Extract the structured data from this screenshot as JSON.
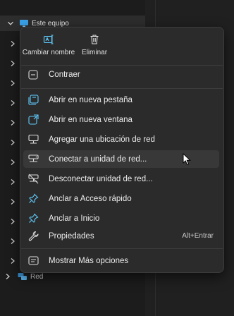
{
  "tree": {
    "root_label": "Este equipo",
    "network_label": "Red"
  },
  "menu": {
    "top_actions": [
      {
        "label": "Cambiar nombre",
        "icon": "rename-icon"
      },
      {
        "label": "Eliminar",
        "icon": "trash-icon"
      }
    ],
    "items": [
      {
        "label": "Contraer",
        "icon": "collapse-icon"
      },
      {
        "label": "Abrir en nueva pestaña",
        "icon": "new-tab-icon"
      },
      {
        "label": "Abrir en nueva ventana",
        "icon": "new-window-icon"
      },
      {
        "label": "Agregar una ubicación de red",
        "icon": "add-network-location-icon"
      },
      {
        "label": "Conectar a unidad de red...",
        "icon": "map-network-drive-icon"
      },
      {
        "label": "Desconectar unidad de red...",
        "icon": "disconnect-network-drive-icon"
      },
      {
        "label": "Anclar a Acceso rápido",
        "icon": "pin-icon"
      },
      {
        "label": "Anclar a Inicio",
        "icon": "pin-icon"
      },
      {
        "label": "Propiedades",
        "icon": "wrench-icon",
        "shortcut": "Alt+Entrar"
      },
      {
        "label": "Mostrar Más opciones",
        "icon": "more-options-icon"
      }
    ]
  },
  "colors": {
    "accent": "#60cdff",
    "menu_background": "#2b2b2b",
    "hover_background": "#383838"
  }
}
